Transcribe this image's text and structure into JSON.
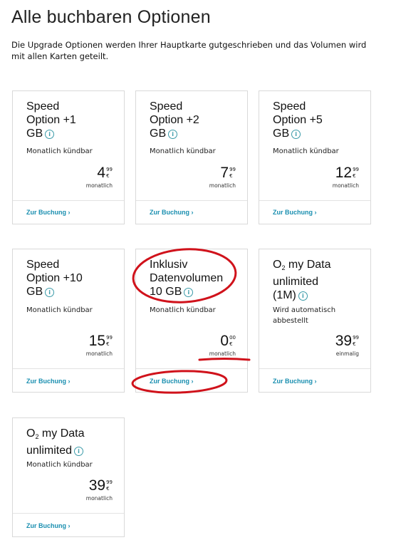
{
  "page": {
    "title": "Alle buchbaren Optionen",
    "intro": "Die Upgrade Optionen werden Ihrer Hauptkarte gutgeschrieben und das Volumen wird mit allen Karten geteilt."
  },
  "cards": [
    {
      "line1": "Speed",
      "line2": "Option +1",
      "line3": "GB",
      "subtitle": "Monatlich kündbar",
      "price_main": "4",
      "price_cents": "99",
      "currency": "€",
      "price_note": "monatlich",
      "link": "Zur Buchung ›"
    },
    {
      "line1": "Speed",
      "line2": "Option +2",
      "line3": "GB",
      "subtitle": "Monatlich kündbar",
      "price_main": "7",
      "price_cents": "99",
      "currency": "€",
      "price_note": "monatlich",
      "link": "Zur Buchung ›"
    },
    {
      "line1": "Speed",
      "line2": "Option +5",
      "line3": "GB",
      "subtitle": "Monatlich kündbar",
      "price_main": "12",
      "price_cents": "99",
      "currency": "€",
      "price_note": "monatlich",
      "link": "Zur Buchung ›"
    },
    {
      "line1": "Speed",
      "line2": "Option +10",
      "line3": "GB",
      "subtitle": "Monatlich kündbar",
      "price_main": "15",
      "price_cents": "99",
      "currency": "€",
      "price_note": "monatlich",
      "link": "Zur Buchung ›"
    },
    {
      "line1": "Inklusiv",
      "line2": "Datenvolumen",
      "line3": "10 GB",
      "subtitle": "Monatlich kündbar",
      "price_main": "0",
      "price_cents": "00",
      "currency": "€",
      "price_note": "monatlich",
      "link": "Zur Buchung ›"
    },
    {
      "brand": "O",
      "brand_sub": "2",
      "line1": " my Data",
      "line2": "unlimited",
      "line3": "(1M)",
      "subtitle": "Wird automatisch abbestellt",
      "price_main": "39",
      "price_cents": "99",
      "currency": "€",
      "price_note": "einmalig",
      "link": "Zur Buchung ›"
    },
    {
      "brand": "O",
      "brand_sub": "2",
      "line1": " my Data",
      "line2": "unlimited",
      "subtitle": "Monatlich kündbar",
      "price_main": "39",
      "price_cents": "99",
      "currency": "€",
      "price_note": "monatlich",
      "link": "Zur Buchung ›"
    }
  ],
  "icons": {
    "info": "info-icon",
    "link_chevron": "chevron-right"
  },
  "colors": {
    "link": "#1a8fb0",
    "info_icon": "#3a9aa8",
    "annotation": "#d0121b"
  }
}
